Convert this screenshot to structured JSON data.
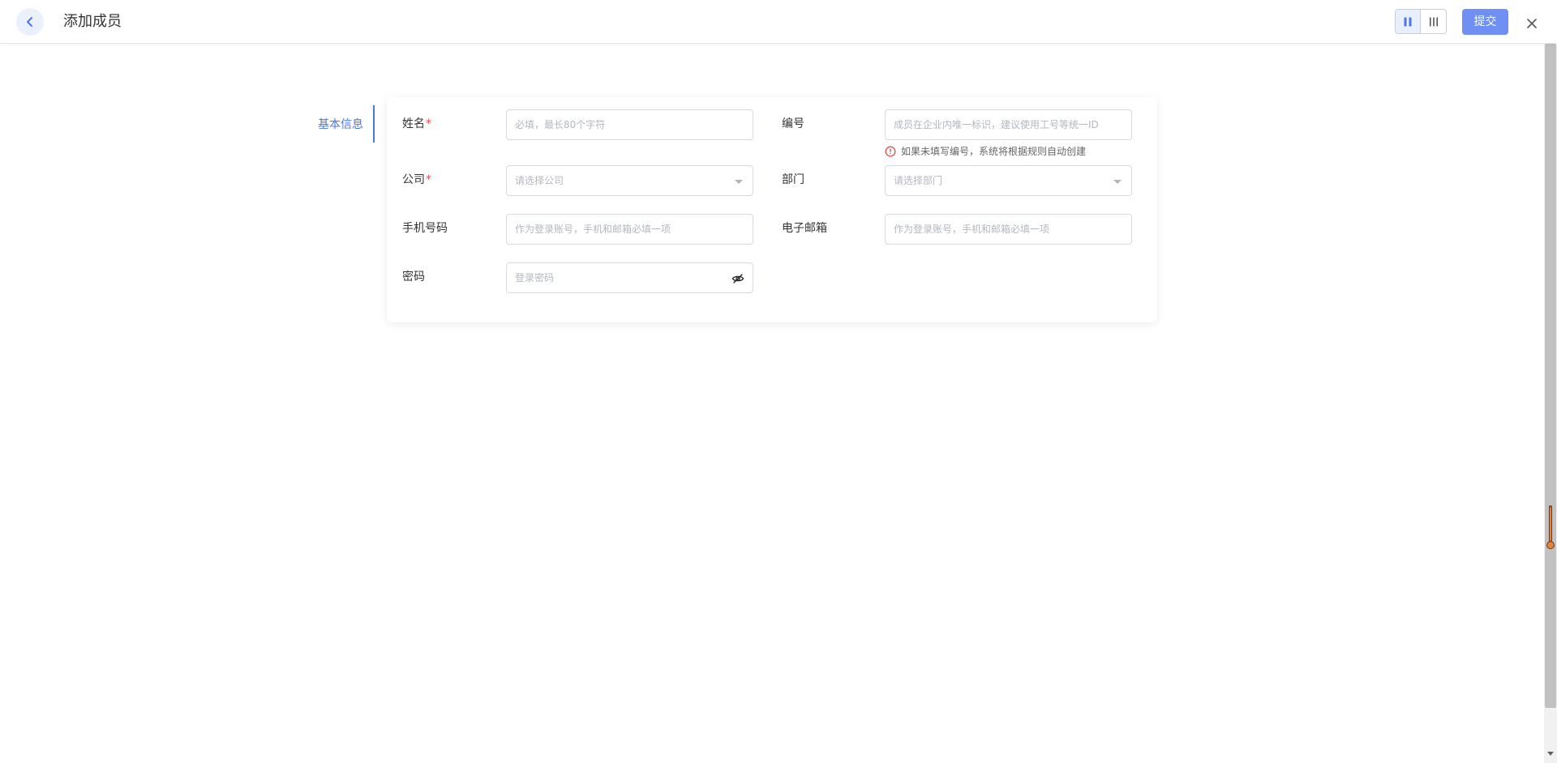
{
  "header": {
    "title": "添加成员",
    "submit_label": "提交"
  },
  "section_nav": {
    "label": "基本信息"
  },
  "form": {
    "name": {
      "label": "姓名",
      "required_mark": "*",
      "placeholder": "必填，最长80个字符"
    },
    "number": {
      "label": "编号",
      "placeholder": "成员在企业内唯一标识，建议使用工号等统一ID",
      "hint": "如果未填写编号，系统将根据规则自动创建"
    },
    "company": {
      "label": "公司",
      "required_mark": "*",
      "placeholder": "请选择公司"
    },
    "department": {
      "label": "部门",
      "placeholder": "请选择部门"
    },
    "phone": {
      "label": "手机号码",
      "placeholder": "作为登录账号，手机和邮箱必填一项"
    },
    "email": {
      "label": "电子邮箱",
      "placeholder": "作为登录账号，手机和邮箱必填一项"
    },
    "password": {
      "label": "密码",
      "placeholder": "登录密码"
    }
  },
  "colors": {
    "primary": "#4b74e6",
    "submit_bg": "#6f8ff2",
    "required": "#e24c4c",
    "hint_icon": "#e24c4c"
  },
  "icons": {
    "back": "chevron-left-icon",
    "layout_two": "two-column-icon",
    "layout_three": "three-column-icon",
    "close": "close-icon",
    "eye": "eye-slash-icon",
    "hint": "alert-circle-icon"
  }
}
